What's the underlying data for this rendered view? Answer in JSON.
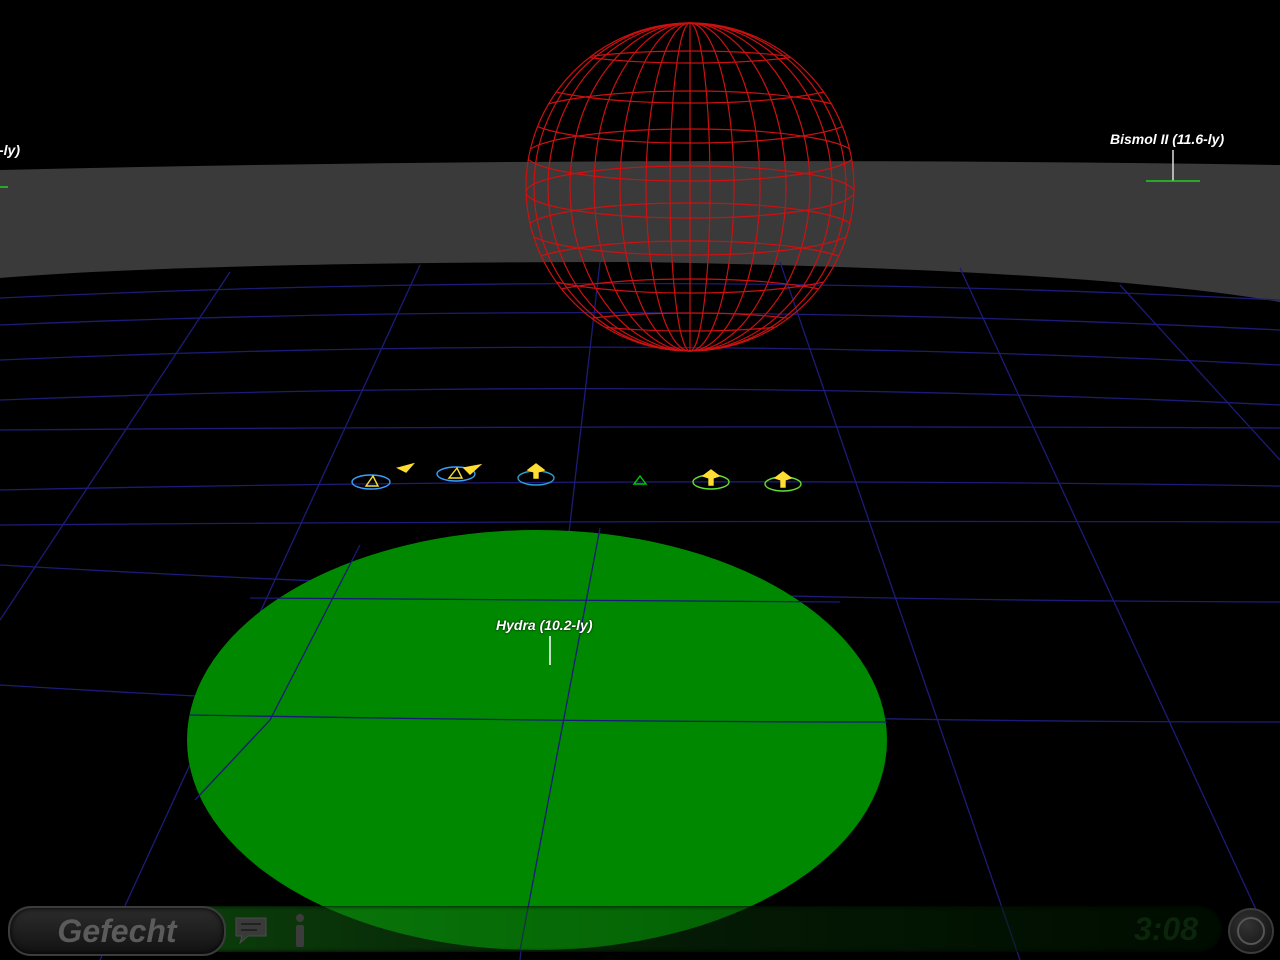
{
  "map": {
    "systems": [
      {
        "name": "Bismol II (11.6-ly)"
      },
      {
        "name": "Hydra (10.2-ly)"
      },
      {
        "name": "-ly)"
      }
    ],
    "colors": {
      "background": "#000000",
      "grid": "#1a1a70",
      "horizon_band": "#3a3a3a",
      "hydra_zone": "#008800",
      "sphere": "#cc1111"
    }
  },
  "fleet": {
    "units": [
      {
        "icon": "fighter-unit-icon",
        "color": "#3aa0ff"
      },
      {
        "icon": "fighter-unit-icon",
        "color": "#3aa0ff"
      },
      {
        "icon": "frigate-unit-icon",
        "color": "#2f9fcf"
      },
      {
        "icon": "waypoint-triangle-icon",
        "color": "#00cc00"
      },
      {
        "icon": "frigate-unit-icon",
        "color": "#66dd33"
      },
      {
        "icon": "frigate-unit-icon",
        "color": "#66dd33"
      }
    ]
  },
  "hud": {
    "mode_label": "Gefecht",
    "timer": "3:08",
    "icons": [
      "chat-icon",
      "info-icon",
      "menu-icon"
    ]
  }
}
